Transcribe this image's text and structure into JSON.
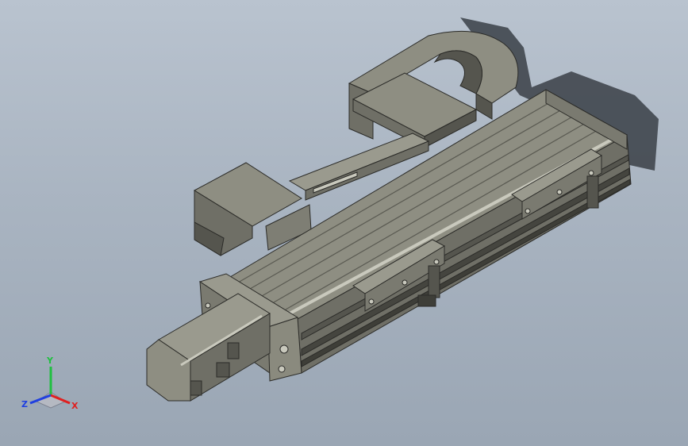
{
  "viewport": {
    "background_top": "#b9c3cf",
    "background_bottom": "#9aa6b4"
  },
  "model": {
    "colors": {
      "body_top": "#8e8e82",
      "body_side": "#6f6f66",
      "body_dark": "#55554e",
      "edge": "#2b2b28",
      "highlight": "#c9c9bd",
      "shadow": "#3a3f47"
    }
  },
  "triad": {
    "x_label": "X",
    "y_label": "Y",
    "z_label": "Z",
    "x_color": "#e02020",
    "y_color": "#20c040",
    "z_color": "#2040e0"
  }
}
